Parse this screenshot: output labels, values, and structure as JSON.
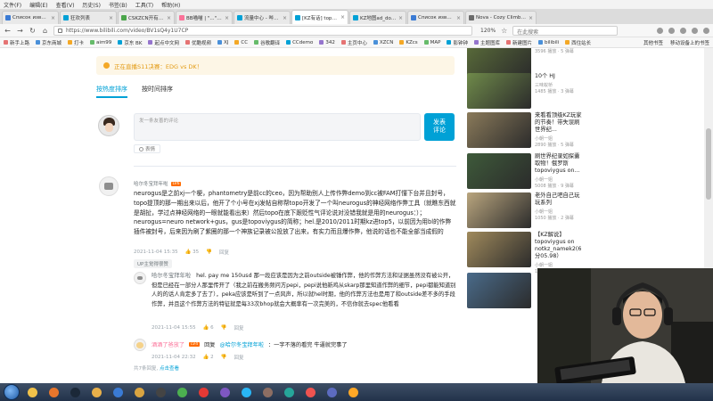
{
  "menubar": {
    "items": [
      "文件(F)",
      "编辑(E)",
      "查看(V)",
      "历史(S)",
      "书签(B)",
      "工具(T)",
      "帮助(H)"
    ]
  },
  "tabs": [
    {
      "label": "Список известных мап",
      "active": false,
      "color": "#3b7bd4"
    },
    {
      "label": "狂欢列表",
      "active": false,
      "color": "#00a1d6"
    },
    {
      "label": "CSKZCN开有他的共享 - Ks",
      "active": false,
      "color": "#4aa54a"
    },
    {
      "label": "BB喵喵 | \"...\"|>口 予积",
      "active": false,
      "color": "#fb7299"
    },
    {
      "label": "流量中心 - 哔哩哔哩弹幕视频网",
      "active": false,
      "color": "#00a1d6"
    },
    {
      "label": "[KZ有话] topoviygus...",
      "active": true,
      "color": "#00a1d6"
    },
    {
      "label": "KZ地图ad_downstairs开拓",
      "active": false,
      "color": "#00a1d6"
    },
    {
      "label": "Список известных мап",
      "active": false,
      "color": "#3b7bd4"
    },
    {
      "label": "Nova - Cozy Climbing",
      "active": false,
      "color": "#6b6b6b"
    }
  ],
  "navbar": {
    "url": "https://www.bilibili.com/video/BV1sQ4y1U7CP",
    "zoom": "120%",
    "search_placeholder": "在此搜索"
  },
  "bookmarks": {
    "items": [
      "新手上路",
      "京东商城",
      "打卡",
      "aim99",
      "京东 BK",
      "起点中文网",
      "优酷视频",
      "XJ",
      "CC",
      "谷歌翻译",
      "CCdemo",
      "342",
      "主页中心",
      "XZCN",
      "KZcs",
      "MAP",
      "影钟钟",
      "主题图库",
      "新建图片",
      "bilibili",
      "西住站长"
    ],
    "right_items": [
      "其他书签",
      "移动设备上的书签"
    ]
  },
  "live_banner": {
    "text": "正在直播S11决赛：EDG vs DK！"
  },
  "sort_tabs": [
    {
      "label": "按热度排序",
      "active": true
    },
    {
      "label": "按时间排序",
      "active": false
    }
  ],
  "editor": {
    "placeholder": "发一条友善的评论",
    "send_label": "发表\n评论",
    "emoji_label": "表情"
  },
  "comment": {
    "username": "哈尔冬宝拜年啦",
    "level": "LV6",
    "text": "neurogus是之前xj一个梗，phantometry是前cc的ceo，因为帮助别人上传作弊demo到cc被FAM打懂下台并且封号，topo提顶的那一期出来以后，他开了个小号在xj发帖自称帮topo开发了一个叫neurogus的神经网络作弊工具（就瞧东西就是胡扯，学过点神经网络的一眼就能看出来）然后topo在底下跟贬性气评论说对没错我就是用的neurogus：）；neurogus=neuro network+gus，gus是topoviygus的简称；hel.是2010/2011时期kz进top5，以前因为用bl的作弊插件被封号，后来因为刷了紫圈的那一个神族记录被公投放了出来，有实力而且爆作弊，他说的话也不能全部当成假的",
    "time": "2021-11-04 15:35",
    "likes": "35",
    "reply_label": "回复",
    "badge": "UP主觉得很赞"
  },
  "replies": [
    {
      "username": "哈尔冬宝拜年啦",
      "level": "LV6",
      "text": "hel. pay me 150usd 那一段应该是因为之前outside被锤作弊，他的作弊方法和证据虽然没有被公开，但是已经在一部分人那里传开了（我之前在搬务频问方pepi，pepi说他新鸡从skarp那里知道作弊的细节，pepi都能知道别人的的话人肯定多了去了），peka应该是听到了一点风声，所以就hel时期，他的作弊方法也是用了和outside差不多的手段作弊，并且这个作弊方法的特征就是每33次bhop就会大概率有一次完美的，不信你就去spec他看看",
      "time": "2021-11-04 15:55",
      "likes": "6",
      "reply_label": "回复"
    },
    {
      "username": "酒酒了爸放了",
      "level": "LV4",
      "reply_word": "回复",
      "mention": "@哈尔冬宝拜年啦",
      "text": "：一字不落的看完 牛逼就完事了",
      "time": "2021-11-04 22:32",
      "likes": "2",
      "reply_label": "回复"
    }
  ],
  "more_replies": {
    "prefix": "共7条回复,",
    "link": "点击查看"
  },
  "recommendations": [
    {
      "title": "",
      "up": "xj_1337",
      "stats": "3596 播放 · 5 弹幕",
      "color": "#5b6e3a"
    },
    {
      "title": "10个 HJ",
      "up": "三味蚁桥",
      "stats": "1485 播放 · 3 弹幕",
      "color": "#6f8a4a"
    },
    {
      "title": "来看看顶级KZ玩家的节奏！带失误刷世界纪...",
      "up": "小朝一姐",
      "stats": "2890 播放 · 5 弹幕",
      "color": "#8a7a5a"
    },
    {
      "title": "刷世界纪录如探囊取物！俄罗斯topoviygus on...",
      "up": "小朝一姐",
      "stats": "5008 播放 · 9 弹幕",
      "color": "#3e5a3a"
    },
    {
      "title": "老外自己吧自己玩玩系列",
      "up": "小朝一姐",
      "stats": "1050 播放 · 2 弹幕",
      "color": "#b9a57e"
    },
    {
      "title": "【KZ解说】topoviygus on notkz_namek2(6分05.98）",
      "up": "小朝一姐",
      "stats": "1896 播放 · 1 弹幕",
      "color": "#a08a5c"
    },
    {
      "title": "",
      "up": "",
      "stats": "",
      "color": "#4a6b8a"
    }
  ],
  "taskbar": {
    "icons": [
      "explorer-icon",
      "firefox-icon",
      "steam-icon",
      "folder-icon",
      "media-icon",
      "csgo-icon",
      "obs-icon",
      "chrome-icon",
      "app-icon",
      "app2-icon",
      "app3-icon",
      "app4-icon",
      "qq-icon",
      "browser-icon",
      "app5-icon",
      "app6-icon"
    ]
  },
  "colors": {
    "accent": "#00a1d6",
    "banner_text": "#e39b14",
    "pink": "#fb7299"
  }
}
